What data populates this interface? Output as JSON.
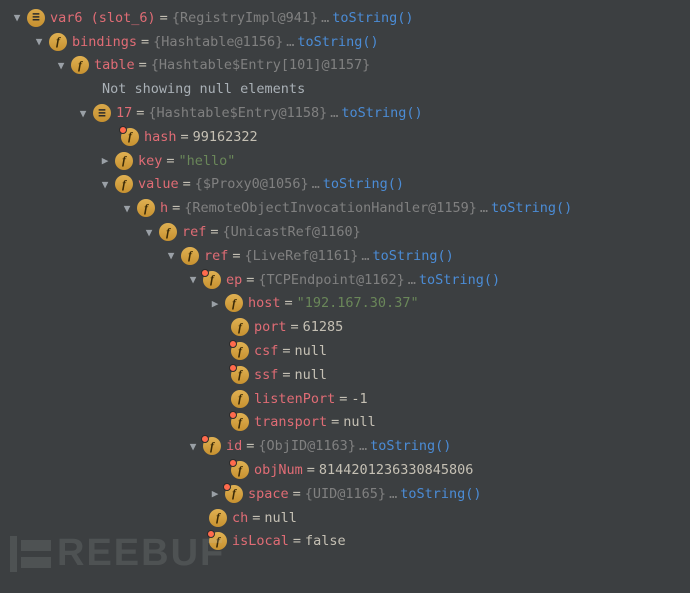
{
  "root": {
    "name": "var6 (slot_6)",
    "type": "{RegistryImpl@941}",
    "link": "toString()"
  },
  "bindings": {
    "name": "bindings",
    "type": "{Hashtable@1156}",
    "link": "toString()"
  },
  "table": {
    "name": "table",
    "type": "{Hashtable$Entry[101]@1157}"
  },
  "nullmsg": "Not showing null elements",
  "entry": {
    "name": "17",
    "type": "{Hashtable$Entry@1158}",
    "link": "toString()"
  },
  "hash": {
    "name": "hash",
    "value": "99162322"
  },
  "key": {
    "name": "key",
    "value": "\"hello\""
  },
  "value": {
    "name": "value",
    "type": "{$Proxy0@1056}",
    "link": "toString()"
  },
  "h": {
    "name": "h",
    "type": "{RemoteObjectInvocationHandler@1159}",
    "link": "toString()"
  },
  "ref1": {
    "name": "ref",
    "type": "{UnicastRef@1160}"
  },
  "ref2": {
    "name": "ref",
    "type": "{LiveRef@1161}",
    "link": "toString()"
  },
  "ep": {
    "name": "ep",
    "type": "{TCPEndpoint@1162}",
    "link": "toString()"
  },
  "host": {
    "name": "host",
    "value": "\"192.167.30.37\""
  },
  "port": {
    "name": "port",
    "value": "61285"
  },
  "csf": {
    "name": "csf",
    "value": "null"
  },
  "ssf": {
    "name": "ssf",
    "value": "null"
  },
  "listenPort": {
    "name": "listenPort",
    "value": "-1"
  },
  "transport": {
    "name": "transport",
    "value": "null"
  },
  "id": {
    "name": "id",
    "type": "{ObjID@1163}",
    "link": "toString()"
  },
  "objNum": {
    "name": "objNum",
    "value": "8144201236330845806"
  },
  "space": {
    "name": "space",
    "type": "{UID@1165}",
    "link": "toString()"
  },
  "ch": {
    "name": "ch",
    "value": "null"
  },
  "isLocal": {
    "name": "isLocal",
    "value": "false"
  },
  "ellipsis": "…",
  "watermark": "REEBUF"
}
